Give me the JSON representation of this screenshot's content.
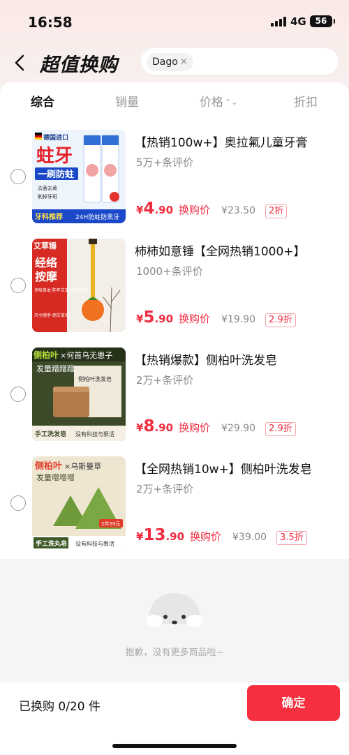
{
  "status_bar": {
    "time": "16:58",
    "network": "4G",
    "battery": "56"
  },
  "header": {
    "title": "超值换购",
    "search_tag": "Dago",
    "tag_close": "×"
  },
  "sort_tabs": [
    {
      "label": "综合",
      "active": true
    },
    {
      "label": "销量",
      "active": false
    },
    {
      "label": "价格",
      "active": false
    },
    {
      "label": "折扣",
      "active": false
    }
  ],
  "items": [
    {
      "title": "【热销100w+】奥拉氟儿童牙膏",
      "reviews": "5万+条评价",
      "currency": "¥",
      "price_int": "4",
      "price_dec": ".90",
      "price_label": "换购价",
      "original_price": "¥23.50",
      "discount": "2折",
      "thumb": {
        "flag_text": "德国进口",
        "big1": "蛀牙",
        "big2": "一刷防蛀",
        "tag1": "去菌去黄",
        "tag2": "刷掉牙斑",
        "footer1": "牙科推荐",
        "footer2": "24H防蛀防黑牙"
      }
    },
    {
      "title": "柿柿如意锤【全网热销1000+】",
      "reviews": "1000+条评价",
      "currency": "¥",
      "price_int": "5",
      "price_dec": ".90",
      "price_label": "换购价",
      "original_price": "¥19.90",
      "discount": "2.9折",
      "thumb": {
        "head": "艾草锤",
        "big1": "经络",
        "big2": "按摩",
        "lines": "多味草本 陈年艾草 手工制作",
        "footer": "尺寸顺手 倒艾草锤"
      }
    },
    {
      "title": "【热销爆款】侧柏叶洗发皂",
      "reviews": "2万+条评价",
      "currency": "¥",
      "price_int": "8",
      "price_dec": ".90",
      "price_label": "换购价",
      "original_price": "¥29.90",
      "discount": "2.9折",
      "thumb": {
        "head1": "侧柏叶",
        "head2": "×何首乌无患子",
        "line": "发量蹭蹭蹭",
        "box": "侧柏叶洗发皂",
        "foot1": "手工洗发皂",
        "foot2": "没有科技与狠活"
      }
    },
    {
      "title": "【全网热销10w+】侧柏叶洗发皂",
      "reviews": "2万+条评价",
      "currency": "¥",
      "price_int": "13",
      "price_dec": ".90",
      "price_label": "换购价",
      "original_price": "¥39.00",
      "discount": "3.5折",
      "thumb": {
        "head1": "侧柏叶",
        "head2": "×乌斯曼草",
        "line": "发量噌噌噌",
        "badge": "2件59元",
        "foot1": "手工洗丸皂",
        "foot2": "没有科技与狠活"
      }
    }
  ],
  "empty_state": {
    "text": "抱歉，没有更多商品啦~"
  },
  "bottom_bar": {
    "count_text": "已换购 0/20 件",
    "confirm_label": "确定"
  },
  "colors": {
    "accent": "#f52f3e",
    "price": "#f02c3f"
  }
}
